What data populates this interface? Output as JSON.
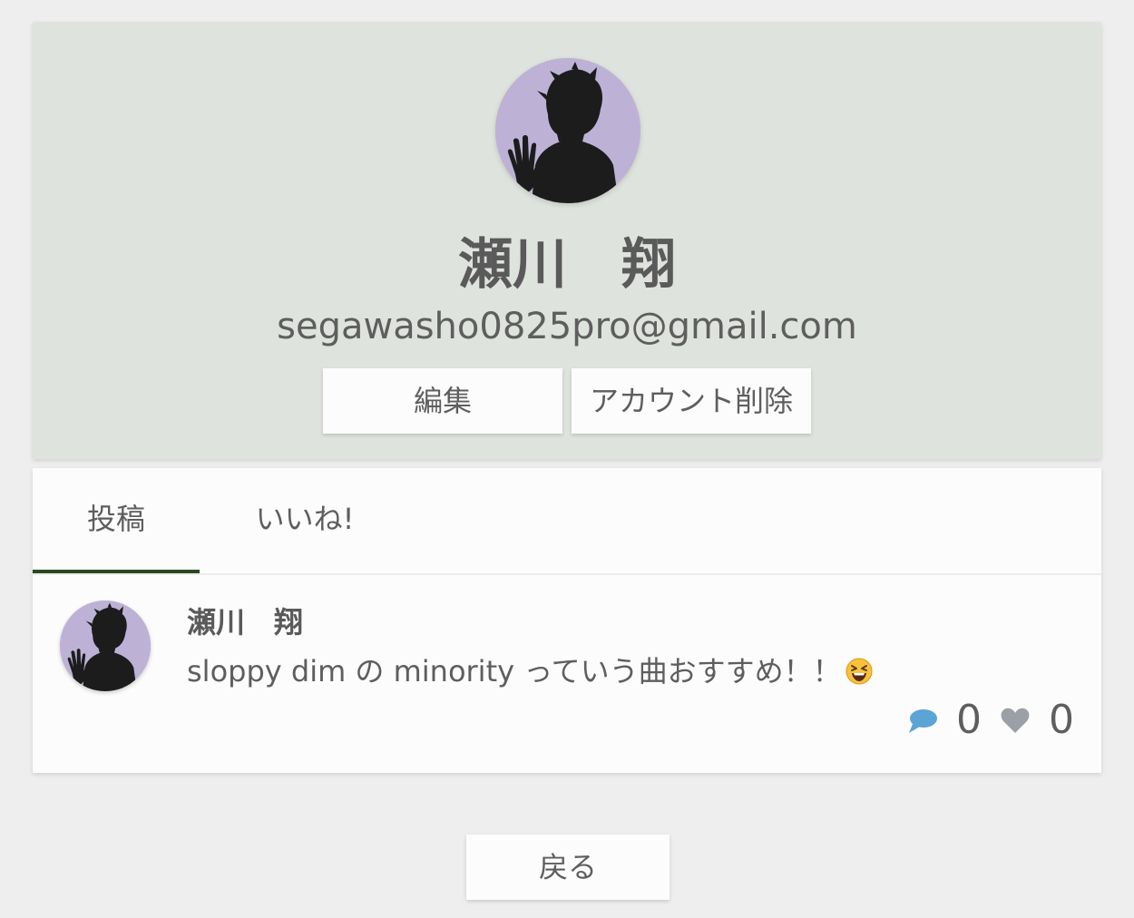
{
  "profile": {
    "name": "瀬川　翔",
    "email": "segawasho0825pro@gmail.com",
    "edit_label": "編集",
    "delete_label": "アカウント削除",
    "avatar_bg": "#bdb2d6"
  },
  "tabs": [
    {
      "label": "投稿",
      "active": true
    },
    {
      "label": "いいね!",
      "active": false
    }
  ],
  "posts": [
    {
      "author": "瀬川　翔",
      "text": "sloppy dim の minority っていう曲おすすめ！！",
      "emoji": "grinning-squinting-face",
      "comment_count": "0",
      "like_count": "0"
    }
  ],
  "back_label": "戻る",
  "colors": {
    "profile_bg": "#dfe3dd",
    "tab_indicator": "#2a4a22",
    "comment_icon": "#5ba5d4",
    "like_icon": "#9aa0a6"
  }
}
